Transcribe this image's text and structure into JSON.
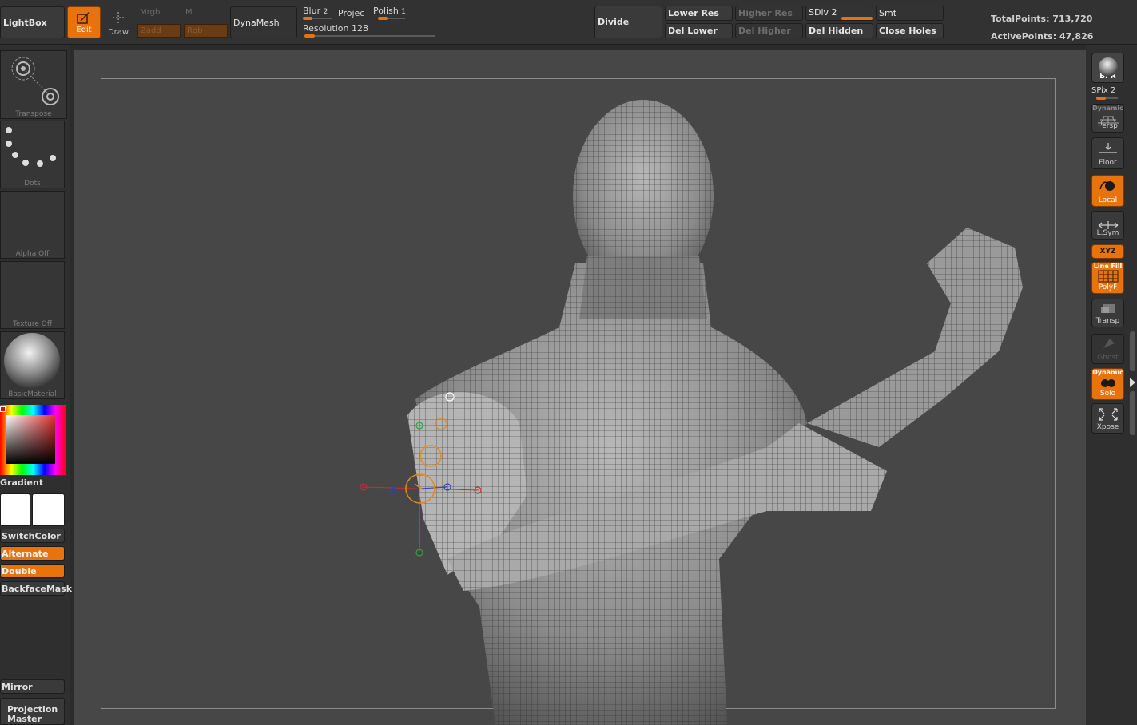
{
  "topbar": {
    "lightbox": "LightBox",
    "edit": "Edit",
    "draw": "Draw",
    "mrgb": "Mrgb",
    "m": "M",
    "zadd": "Zadd",
    "rgb": "Rgb",
    "dynamesh": "DynaMesh",
    "blur": "Blur",
    "blur_value": "2",
    "project": "Projec",
    "polish": "Polish",
    "polish_value": "1",
    "resolution_label": "Resolution",
    "resolution_value": "128",
    "divide": "Divide",
    "lower_res": "Lower Res",
    "higher_res": "Higher Res",
    "sdiv": "SDiv 2",
    "smt": "Smt",
    "del_lower": "Del Lower",
    "del_higher": "Del Higher",
    "del_hidden": "Del Hidden",
    "close_holes": "Close Holes",
    "total_points": "TotalPoints: 713,720",
    "active_points": "ActivePoints: 47,826"
  },
  "leftpanel": {
    "transpose": "Transpose",
    "dots": "Dots",
    "alpha": "Alpha  Off",
    "texture": "Texture  Off",
    "material": "BasicMaterial",
    "gradient": "Gradient",
    "switch_color": "SwitchColor",
    "alternate": "Alternate",
    "double": "Double",
    "backface_mask": "BackfaceMask",
    "mirror": "Mirror",
    "projection_master": "Projection Master"
  },
  "rightshelf": {
    "bpr": "BPR",
    "spix": "SPix 2",
    "persp_top": "Dynamic",
    "persp": "Persp",
    "floor": "Floor",
    "local": "Local",
    "lsym": "L.Sym",
    "xyz": "XYZ",
    "polyf_top": "Line Fill",
    "polyf": "PolyF",
    "transp": "Transp",
    "ghost": "Ghost",
    "solo_top": "Dynamic",
    "solo": "Solo",
    "xpose": "Xpose"
  },
  "colors": {
    "accent": "#e8730c",
    "panel": "#323232",
    "canvas": "#474747"
  }
}
